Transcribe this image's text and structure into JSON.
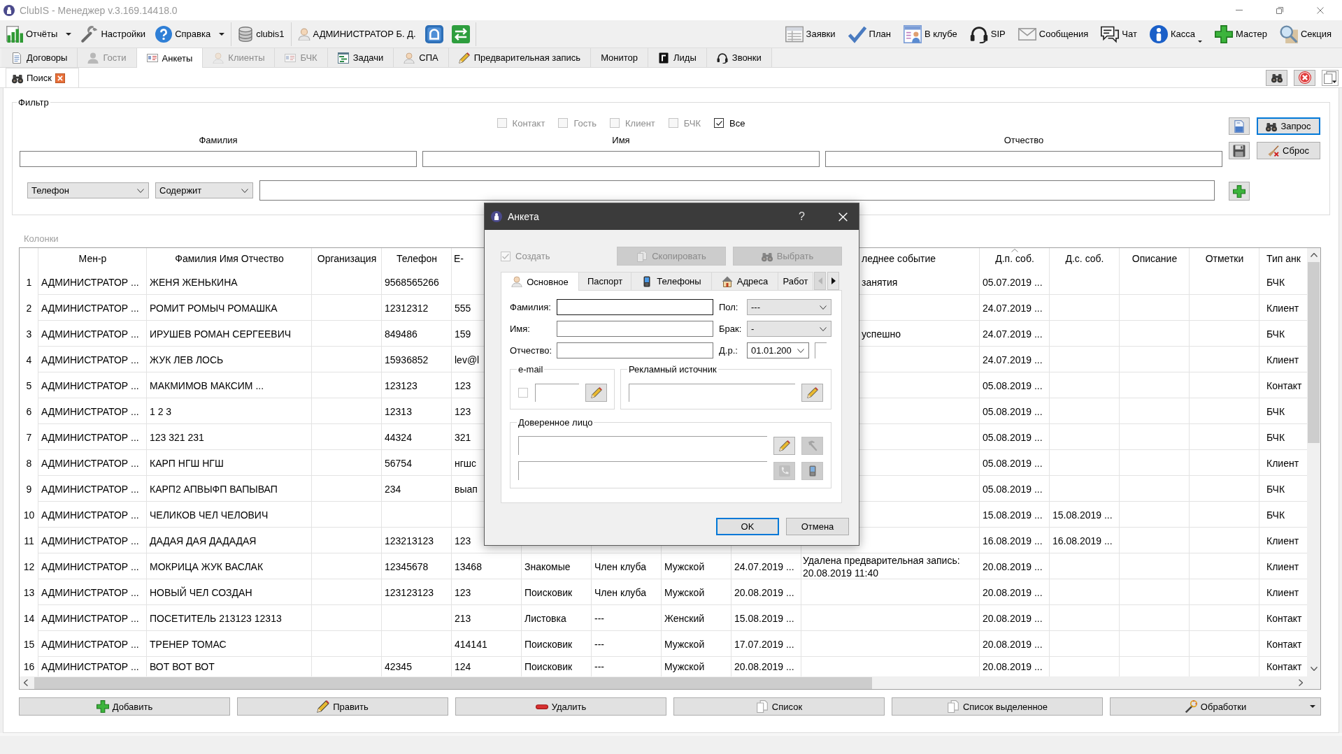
{
  "window": {
    "title": "ClubIS - Менеджер v.3.169.14418.0"
  },
  "toolbar": {
    "left": [
      {
        "label": "Отчёты",
        "menu": true
      },
      {
        "label": "Настройки",
        "menu": false
      },
      {
        "label": "Справка",
        "menu": true
      }
    ],
    "database": "clubis1",
    "user": "АДМИНИСТРАТОР Б. Д.",
    "right": [
      {
        "label": "Заявки",
        "menu": false
      },
      {
        "label": "План",
        "menu": false
      },
      {
        "label": "В клубе",
        "menu": false
      },
      {
        "label": "SIP",
        "menu": false
      },
      {
        "label": "Сообщения",
        "menu": false
      },
      {
        "label": "Чат",
        "menu": false
      },
      {
        "label": "Касса",
        "menu": true
      },
      {
        "label": "Мастер",
        "menu": false
      },
      {
        "label": "Секция",
        "menu": false
      }
    ]
  },
  "tabs": [
    {
      "label": "Договоры",
      "selected": false,
      "disabled": false
    },
    {
      "label": "Гости",
      "selected": false,
      "disabled": true
    },
    {
      "label": "Анкеты",
      "selected": true,
      "disabled": false
    },
    {
      "label": "Клиенты",
      "selected": false,
      "disabled": true
    },
    {
      "label": "БЧК",
      "selected": false,
      "disabled": true
    },
    {
      "label": "Задачи",
      "selected": false,
      "disabled": false
    },
    {
      "label": "СПА",
      "selected": false,
      "disabled": false
    },
    {
      "label": "Предварительная запись",
      "selected": false,
      "disabled": false
    },
    {
      "label": "Монитор",
      "selected": false,
      "disabled": false
    },
    {
      "label": "Лиды",
      "selected": false,
      "disabled": false
    },
    {
      "label": "Звонки",
      "selected": false,
      "disabled": false
    }
  ],
  "subtabs": [
    {
      "label": "Поиск",
      "selected": true
    }
  ],
  "filter": {
    "title": "Фильтр",
    "types": [
      {
        "label": "Контакт",
        "checked": false,
        "disabled": true
      },
      {
        "label": "Гость",
        "checked": false,
        "disabled": true
      },
      {
        "label": "Клиент",
        "checked": false,
        "disabled": true
      },
      {
        "label": "БЧК",
        "checked": false,
        "disabled": true
      },
      {
        "label": "Все",
        "checked": true,
        "disabled": false
      }
    ],
    "name_fields": [
      "Фамилия",
      "Имя",
      "Отчество"
    ],
    "condition": {
      "field": "Телефон",
      "operator": "Содержит"
    },
    "buttons": [
      {
        "label": "Запрос",
        "default": true
      },
      {
        "label": "Сброс",
        "default": false
      }
    ]
  },
  "columns_title": "Колонки",
  "table": {
    "columns": [
      {
        "label": "Мен-р",
        "sorted": false
      },
      {
        "label": "Фамилия Имя Отчество",
        "sorted": false
      },
      {
        "label": "Организация",
        "sorted": false
      },
      {
        "label": "Телефон",
        "sorted": false
      },
      {
        "label": "E-",
        "sorted": false
      },
      {
        "label": "леднее событие",
        "sorted": false
      },
      {
        "label": "Д.п. соб.",
        "sorted": true
      },
      {
        "label": "Д.с. соб.",
        "sorted": false
      },
      {
        "label": "Описание",
        "sorted": false
      },
      {
        "label": "Отметки",
        "sorted": false
      },
      {
        "label": "Тип анк",
        "sorted": false
      }
    ],
    "rows": [
      {
        "number": "1",
        "manager": "АДМИНИСТРАТОР ...",
        "full_name": "ЖЕНЯ ЖЕНЬКИНА",
        "phone": "9568565266",
        "last_event": "занятия",
        "d_p_event": "05.07.2019 ...",
        "form_type": "БЧК"
      },
      {
        "number": "2",
        "manager": "АДМИНИСТРАТОР ...",
        "full_name": "РОМИТ РОМЫЧ РОМАШКА",
        "phone": "12312312",
        "email": "555",
        "d_p_event": "24.07.2019 ...",
        "form_type": "Клиент"
      },
      {
        "number": "3",
        "manager": "АДМИНИСТРАТОР ...",
        "full_name": "ИРУШЕВ РОМАН СЕРГЕЕВИЧ",
        "phone": "849486",
        "email": "159",
        "last_event": "успешно",
        "d_p_event": "24.07.2019 ...",
        "form_type": "БЧК"
      },
      {
        "number": "4",
        "manager": "АДМИНИСТРАТОР ...",
        "full_name": "ЖУК ЛЕВ ЛОСЬ",
        "phone": "15936852",
        "email": "lev@l",
        "d_p_event": "24.07.2019 ...",
        "form_type": "Клиент"
      },
      {
        "number": "5",
        "manager": "АДМИНИСТРАТОР ...",
        "full_name": "МАКМИМОВ МАКСИМ ...",
        "phone": "123123",
        "email": "123",
        "d_p_event": "05.08.2019 ...",
        "form_type": "Контакт"
      },
      {
        "number": "6",
        "manager": "АДМИНИСТРАТОР ...",
        "full_name": "1 2 3",
        "phone": "12313",
        "email": "123",
        "d_p_event": "05.08.2019 ...",
        "form_type": "БЧК"
      },
      {
        "number": "7",
        "manager": "АДМИНИСТРАТОР ...",
        "full_name": "123 321 231",
        "phone": "44324",
        "email": "321",
        "d_p_event": "05.08.2019 ...",
        "form_type": "БЧК"
      },
      {
        "number": "8",
        "manager": "АДМИНИСТРАТОР ...",
        "full_name": "КАРП НГШ НГШ",
        "phone": "56754",
        "email": "нгшс",
        "d_p_event": "05.08.2019 ...",
        "form_type": "Клиент"
      },
      {
        "number": "9",
        "manager": "АДМИНИСТРАТОР ...",
        "full_name": "КАРП2 АПВЫФП ВАПЫВАП",
        "phone": "234",
        "email": "выап",
        "d_p_event": "05.08.2019 ...",
        "form_type": "БЧК"
      },
      {
        "number": "10",
        "manager": "АДМИНИСТРАТОР ...",
        "full_name": "ЧЕЛИКОВ ЧЕЛ ЧЕЛОВИЧ",
        "d_p_event": "15.08.2019 ...",
        "d_s_event": "15.08.2019 ...",
        "form_type": "БЧК"
      },
      {
        "number": "11",
        "manager": "АДМИНИСТРАТОР ...",
        "full_name": "ДАДАЯ ДАЯ ДАДАДАЯ",
        "phone": "123213123",
        "email": "123",
        "d_p_event": "16.08.2019 ...",
        "d_s_event": "16.08.2019 ...",
        "form_type": "Клиент"
      },
      {
        "number": "12",
        "manager": "АДМИНИСТРАТОР ...",
        "full_name": "МОКРИЦА ЖУК ВАСЛАК",
        "phone": "12345678",
        "email": "13468",
        "column_7": "Знакомые",
        "column_8": "Член клуба",
        "column_9": "Мужской",
        "column_10": "24.07.2019 ...",
        "last_event": "Удалена предварительная запись: 20.08.2019 11:40",
        "d_p_event": "20.08.2019 ...",
        "form_type": "Клиент"
      },
      {
        "number": "13",
        "manager": "АДМИНИСТРАТОР ...",
        "full_name": "НОВЫЙ ЧЕЛ СОЗДАН",
        "phone": "123123123",
        "email": "123",
        "column_7": "Поисковик",
        "column_8": "Член клуба",
        "column_9": "Мужской",
        "column_10": "20.08.2019 ...",
        "d_p_event": "20.08.2019 ...",
        "form_type": "Клиент"
      },
      {
        "number": "14",
        "manager": "АДМИНИСТРАТОР ...",
        "full_name": "ПОСЕТИТЕЛЬ 213123 12313",
        "email": "213",
        "column_7": "Листовка",
        "column_8": "---",
        "column_9": "Женский",
        "column_10": "15.08.2019 ...",
        "d_p_event": "20.08.2019 ...",
        "form_type": "Контакт"
      },
      {
        "number": "15",
        "manager": "АДМИНИСТРАТОР ...",
        "full_name": "ТРЕНЕР ТОМАС",
        "email": "414141",
        "column_7": "Поисковик",
        "column_8": "---",
        "column_9": "Мужской",
        "column_10": "17.07.2019 ...",
        "d_p_event": "20.08.2019 ...",
        "form_type": "Контакт"
      },
      {
        "number": "16",
        "manager": "АДМИНИСТРАТОР ...",
        "full_name": "ВОТ ВОТ ВОТ",
        "phone": "42345",
        "email": "124",
        "column_7": "Поисковик",
        "column_8": "---",
        "column_9": "Мужской",
        "column_10": "20.08.2019 ...",
        "d_p_event": "20.08.2019 ...",
        "form_type": "Контакт"
      }
    ]
  },
  "actions": [
    {
      "label": "Добавить",
      "menu": false
    },
    {
      "label": "Править",
      "menu": false
    },
    {
      "label": "Удалить",
      "menu": false
    },
    {
      "label": "Список",
      "menu": false
    },
    {
      "label": "Список выделенное",
      "menu": false
    },
    {
      "label": "Обработки",
      "menu": true
    }
  ],
  "dialog": {
    "title": "Анкета",
    "help": "?",
    "create": {
      "label": "Создать",
      "checked": true,
      "disabled": true
    },
    "actions": [
      {
        "label": "Скопировать",
        "disabled": true
      },
      {
        "label": "Выбрать",
        "disabled": true
      }
    ],
    "tabs": [
      {
        "label": "Основное",
        "selected": true
      },
      {
        "label": "Паспорт",
        "selected": false
      },
      {
        "label": "Телефоны",
        "selected": false
      },
      {
        "label": "Адреса",
        "selected": false
      },
      {
        "label": "Работ",
        "selected": false
      }
    ],
    "tab_scroll": {
      "back_disabled": true,
      "forward_disabled": false
    },
    "name_fields": [
      {
        "label": "Фамилия:",
        "focused": true
      },
      {
        "label": "Имя:",
        "focused": false
      },
      {
        "label": "Отчество:",
        "focused": false
      }
    ],
    "choices": [
      {
        "kind": "combo",
        "label": "Пол:",
        "value": "---"
      },
      {
        "kind": "combo",
        "label": "Брак:",
        "value": "-"
      },
      {
        "kind": "date",
        "label": "Д.р.:",
        "value": "01.01.200"
      }
    ],
    "email": {
      "title": "e-mail",
      "checked": false
    },
    "ad_source": {
      "title": "Рекламный источник"
    },
    "trustee": {
      "title": "Доверенное лицо",
      "tools": [
        {
          "disabled": false
        },
        {
          "disabled": true
        },
        {
          "disabled": true
        },
        {
          "disabled": true
        }
      ]
    },
    "buttons": [
      {
        "label": "OK",
        "default": true
      },
      {
        "label": "Отмена",
        "default": false
      }
    ]
  }
}
